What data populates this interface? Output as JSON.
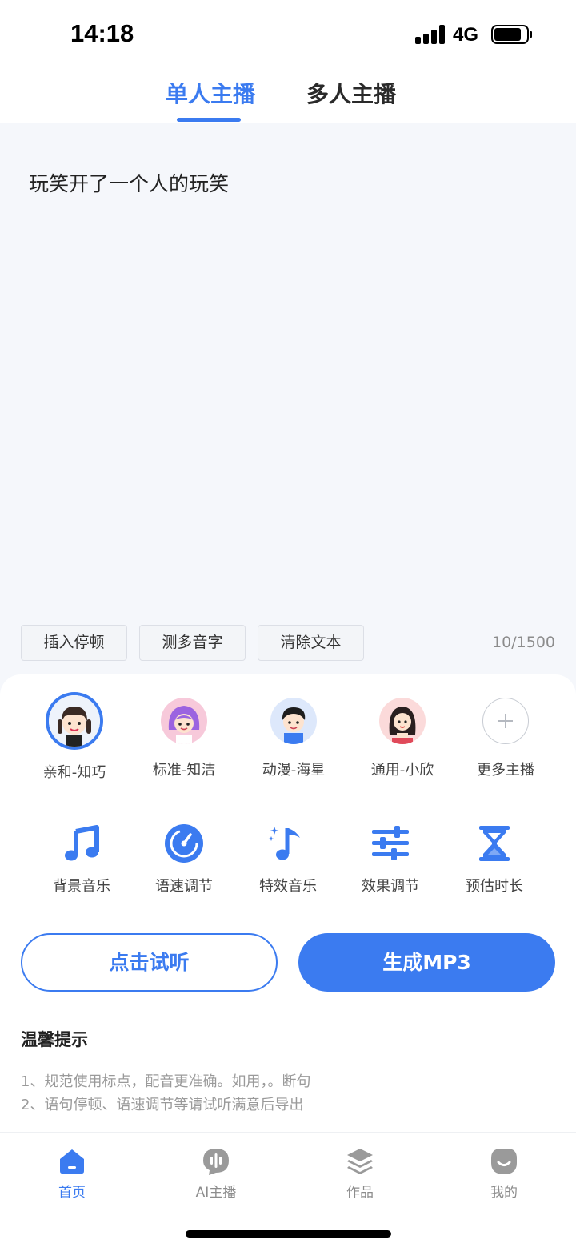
{
  "status": {
    "time": "14:18",
    "network": "4G"
  },
  "tabs": [
    {
      "label": "单人主播",
      "active": true
    },
    {
      "label": "多人主播",
      "active": false
    }
  ],
  "editor": {
    "text": "玩笑开了一个人的玩笑",
    "char_count": "10/1500"
  },
  "tools": [
    {
      "label": "插入停顿"
    },
    {
      "label": "测多音字"
    },
    {
      "label": "清除文本"
    }
  ],
  "anchors": [
    {
      "label": "亲和-知巧",
      "selected": true,
      "icon": "girl-braids-avatar"
    },
    {
      "label": "标准-知洁",
      "selected": false,
      "icon": "girl-purple-hair-avatar"
    },
    {
      "label": "动漫-海星",
      "selected": false,
      "icon": "boy-avatar"
    },
    {
      "label": "通用-小欣",
      "selected": false,
      "icon": "woman-avatar"
    },
    {
      "label": "更多主播",
      "selected": false,
      "icon": "plus-icon"
    }
  ],
  "functions": [
    {
      "label": "背景音乐",
      "icon": "music-note-icon"
    },
    {
      "label": "语速调节",
      "icon": "speedometer-icon"
    },
    {
      "label": "特效音乐",
      "icon": "sparkle-music-icon"
    },
    {
      "label": "效果调节",
      "icon": "sliders-icon"
    },
    {
      "label": "预估时长",
      "icon": "hourglass-icon"
    }
  ],
  "actions": {
    "listen_label": "点击试听",
    "generate_label": "生成MP3"
  },
  "tips": {
    "title": "温馨提示",
    "items": [
      "1、规范使用标点，配音更准确。如用，。断句",
      "2、语句停顿、语速调节等请试听满意后导出"
    ]
  },
  "nav": [
    {
      "label": "首页",
      "active": true,
      "icon": "home-icon"
    },
    {
      "label": "AI主播",
      "active": false,
      "icon": "mic-bubble-icon"
    },
    {
      "label": "作品",
      "active": false,
      "icon": "layers-icon"
    },
    {
      "label": "我的",
      "active": false,
      "icon": "smile-icon"
    }
  ],
  "colors": {
    "accent": "#3b7bf0",
    "background": "#f5f7fb"
  }
}
